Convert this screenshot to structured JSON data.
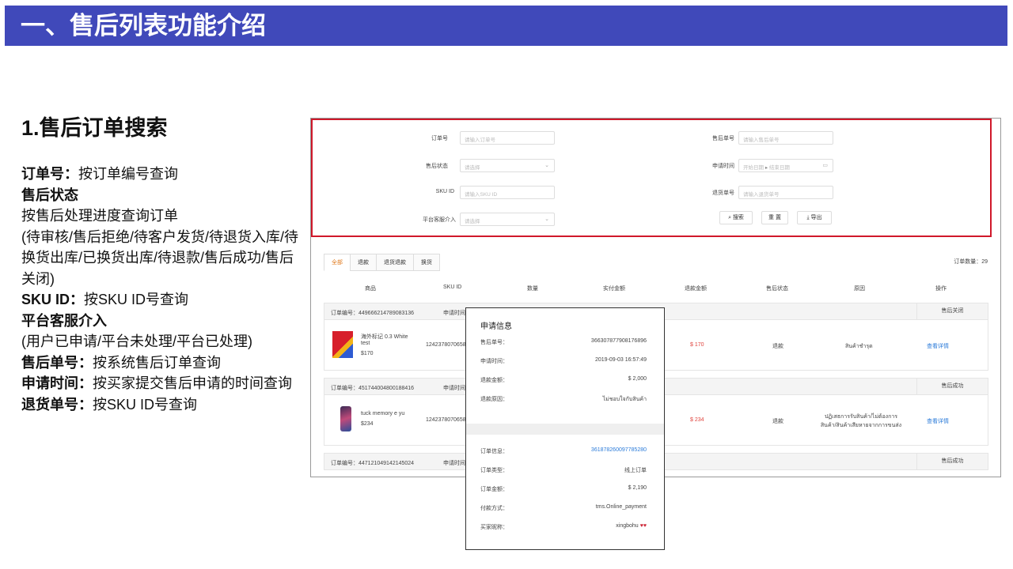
{
  "banner": {
    "title": "一、售后列表功能介绍"
  },
  "left": {
    "heading": "1.售后订单搜索",
    "lines": [
      {
        "bold": "订单号：",
        "text": "按订单编号查询"
      },
      {
        "bold": "售后状态",
        "text": ""
      },
      {
        "bold": "",
        "text": "按售后处理进度查询订单"
      },
      {
        "bold": "",
        "text": "(待审核/售后拒绝/待客户发货/待退货入库/待换货出库/已换货出库/待退款/售后成功/售后关闭)"
      },
      {
        "bold": "SKU ID：",
        "text": "按SKU ID号查询"
      },
      {
        "bold": "平台客服介入",
        "text": ""
      },
      {
        "bold": "",
        "text": "(用户已申请/平台未处理/平台已处理)"
      },
      {
        "bold": "售后单号：",
        "text": "按系统售后订单查询"
      },
      {
        "bold": "申请时间：",
        "text": "按买家提交售后申请的时间查询"
      },
      {
        "bold": "退货单号：",
        "text": "按SKU ID号查询"
      }
    ]
  },
  "search": {
    "order_no_label": "订单号",
    "order_no_ph": "请输入订单号",
    "status_label": "售后状态",
    "status_ph": "请选择",
    "sku_label": "SKU ID",
    "sku_ph": "请输入SKU ID",
    "cs_label": "平台客服介入",
    "cs_ph": "请选择",
    "after_no_label": "售后单号",
    "after_no_ph": "请输入售后单号",
    "time_label": "申请时间",
    "time_start_ph": "开始日期",
    "time_end_ph": "结束日期",
    "return_no_label": "退货单号",
    "return_no_ph": "请输入退货单号",
    "btn_search": "搜索",
    "btn_reset": "重 置",
    "btn_export": "导出"
  },
  "tabs": [
    "全部",
    "退款",
    "退货退款",
    "换货"
  ],
  "order_count": "订单数量：29",
  "columns": [
    "商品",
    "SKU ID",
    "数量",
    "实付金额",
    "退款金额",
    "售后状态",
    "原因",
    "操作"
  ],
  "orders": [
    {
      "header": "订单编号：449666214789083136",
      "apply": "申请时间",
      "status": "售后关闭",
      "product": "海外标记 0.3 White test",
      "price": "$170",
      "sku": "124237807065878",
      "refund": "$ 170",
      "type": "退款",
      "reason": "สินค้าชำรุด",
      "action": "查看详情"
    },
    {
      "header": "订单编号：451744004800188416",
      "apply": "申请时间",
      "status": "售后成功",
      "product": "tuck memory e yu",
      "price": "$234",
      "sku": "124237807065844",
      "refund": "$ 234",
      "type": "退款",
      "reason": "ปฏิเสธการรับสินค้า/ไม่ต้องการสินค้า/สินค้าเสียหายจากการขนส่ง",
      "action": "查看详情"
    },
    {
      "header": "订单编号：447121049142145024",
      "apply": "申请时间",
      "status": "售后成功"
    }
  ],
  "popup": {
    "title": "申请信息",
    "rows": [
      {
        "k": "售后单号：",
        "v": "366307877908176896"
      },
      {
        "k": "申请时间：",
        "v": "2019-09-03 16:57:49"
      },
      {
        "k": "退款金额：",
        "v": "$ 2,000"
      },
      {
        "k": "退款原因：",
        "v": "ไม่ชอบใจกับสินค้า"
      }
    ],
    "rows2": [
      {
        "k": "订单信息：",
        "v": "361878260097785280",
        "link": true
      },
      {
        "k": "订单类型：",
        "v": "线上订单"
      },
      {
        "k": "订单金额：",
        "v": "$ 2,190"
      },
      {
        "k": "付款方式：",
        "v": "tms.Online_payment"
      },
      {
        "k": "买家昵称：",
        "v": "xingbohu"
      }
    ]
  },
  "colors": {
    "banner": "#4049ba",
    "highlight": "#d0182a",
    "active_tab": "#e07b1f",
    "link": "#2b7bd9"
  }
}
